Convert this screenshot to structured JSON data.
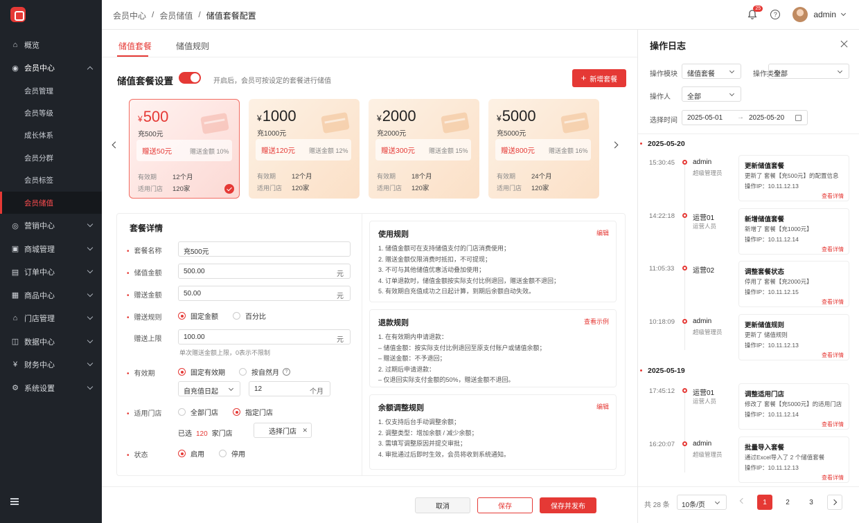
{
  "breadcrumb": {
    "items": [
      "会员中心",
      "会员储值"
    ],
    "current": "储值套餐配置",
    "sep": "/"
  },
  "header": {
    "notification_count": "25",
    "user_name": "admin"
  },
  "sidebar": {
    "items": [
      {
        "label": "概览",
        "icon": "home-icon"
      },
      {
        "label": "会员中心",
        "icon": "member-icon",
        "open": true
      },
      {
        "label": "营销中心",
        "icon": "marketing-icon"
      },
      {
        "label": "商城管理",
        "icon": "mall-icon"
      },
      {
        "label": "订单中心",
        "icon": "order-icon"
      },
      {
        "label": "商品中心",
        "icon": "goods-icon"
      },
      {
        "label": "门店管理",
        "icon": "store-icon"
      },
      {
        "label": "数据中心",
        "icon": "data-icon"
      },
      {
        "label": "财务中心",
        "icon": "finance-icon"
      },
      {
        "label": "系统设置",
        "icon": "settings-icon"
      }
    ],
    "sub_items": [
      "会员管理",
      "会员等级",
      "成长体系",
      "会员分群",
      "会员标签",
      "会员储值"
    ],
    "active_sub": "会员储值"
  },
  "tabs": [
    "储值套餐",
    "储值规则"
  ],
  "section": {
    "title": "储值套餐设置",
    "toggle_on": true,
    "hint": "开启后，会员可按设定的套餐进行储值",
    "add_label": "新增套餐"
  },
  "packages": [
    {
      "currency": "¥",
      "amount": "500",
      "name": "充500元",
      "bonus": "赠送50元",
      "ratio": "赠送金额 10%",
      "validity_label": "有效期",
      "validity": "12个月",
      "stores_label": "适用门店",
      "stores": "120家",
      "selected": true
    },
    {
      "currency": "¥",
      "amount": "1000",
      "name": "充1000元",
      "bonus": "赠送120元",
      "ratio": "赠送金额 12%",
      "validity_label": "有效期",
      "validity": "12个月",
      "stores_label": "适用门店",
      "stores": "120家",
      "selected": false
    },
    {
      "currency": "¥",
      "amount": "2000",
      "name": "充2000元",
      "bonus": "赠送300元",
      "ratio": "赠送金额 15%",
      "validity_label": "有效期",
      "validity": "18个月",
      "stores_label": "适用门店",
      "stores": "120家",
      "selected": false
    },
    {
      "currency": "¥",
      "amount": "5000",
      "name": "充5000元",
      "bonus": "赠送800元",
      "ratio": "赠送金额 16%",
      "validity_label": "有效期",
      "validity": "24个月",
      "stores_label": "适用门店",
      "stores": "120家",
      "selected": false
    }
  ],
  "detail": {
    "title": "套餐详情",
    "name_label": "套餐名称",
    "name_value": "充500元",
    "amount_label": "储值金额",
    "amount_value": "500.00",
    "bonus_label": "赠送金额",
    "bonus_value": "50.00",
    "unit_yuan": "元",
    "rule_label": "赠送规则",
    "rule_fixed": "固定金额",
    "rule_percent": "百分比",
    "cap_label": "赠送上限",
    "cap_value": "100.00",
    "cap_hint": "单次赠送金额上限，0表示不限制",
    "validity_label": "有效期",
    "validity_fixed": "固定有效期",
    "validity_natural": "按自然月",
    "start_select": "自充值日起",
    "months_value": "12",
    "months_unit": "个月",
    "stores_label": "适用门店",
    "stores_all": "全部门店",
    "stores_specified": "指定门店",
    "selected_prefix": "已选",
    "selected_count": "120",
    "selected_suffix": "家门店",
    "select_store_button": "选择门店",
    "status_label": "状态",
    "status_on": "启用",
    "status_off": "停用"
  },
  "rules": [
    {
      "title": "使用规则",
      "action": "编辑",
      "lines": [
        "1. 储值金额可在支持储值支付的门店消费使用；",
        "2. 赠送金额仅限消费时抵扣，不可提现；",
        "3. 不可与其他储值优惠活动叠加使用；",
        "4. 订单退款时，储值金额按实际支付比例退回，赠送金额不退回；",
        "5. 有效期自充值成功之日起计算，到期后余额自动失效。"
      ]
    },
    {
      "title": "退款规则",
      "action": "查看示例",
      "lines": [
        "1. 在有效期内申请退款：",
        "– 储值金额：按实际支付比例退回至原支付账户或储值余额；",
        "– 赠送金额：不予退回；",
        "2. 过期后申请退款：",
        "– 仅退回实际支付金额的50%，赠送金额不退回。"
      ]
    },
    {
      "title": "余额调整规则",
      "action": "编辑",
      "lines": [
        "1. 仅支持后台手动调整余额；",
        "2. 调整类型：增加余额 / 减少余额；",
        "3. 需填写调整原因并提交审批；",
        "4. 审批通过后即时生效，会员将收到系统通知。"
      ]
    }
  ],
  "footer": {
    "cancel": "取消",
    "save": "保存",
    "publish": "保存并发布"
  },
  "log": {
    "title": "操作日志",
    "filters": {
      "module_label": "操作模块",
      "module_value": "储值套餐",
      "type_label": "操作类型",
      "type_value": "全部",
      "operator_label": "操作人",
      "operator_value": "全部",
      "time_label": "选择时间",
      "date_from": "2025-05-01",
      "date_to": "2025-05-20",
      "range_arrow": "→"
    },
    "days": [
      {
        "date": "2025-05-20",
        "entries": [
          {
            "time": "15:30:45",
            "user": "admin",
            "role": "超级管理员",
            "action": "更新储值套餐",
            "desc": "更新了 套餐【充500元】的配置信息",
            "ip": "操作IP：10.11.12.13",
            "link": "查看详情"
          },
          {
            "time": "14:22:18",
            "user": "运营01",
            "role": "运营人员",
            "action": "新增储值套餐",
            "desc": "新增了 套餐【充1000元】",
            "ip": "操作IP：10.11.12.14",
            "link": "查看详情"
          },
          {
            "time": "11:05:33",
            "user": "运营02",
            "role": "",
            "action": "调整套餐状态",
            "desc": "停用了 套餐【充2000元】",
            "ip": "操作IP：10.11.12.15",
            "link": "查看详情"
          },
          {
            "time": "10:18:09",
            "user": "admin",
            "role": "超级管理员",
            "action": "更新储值规则",
            "desc": "更新了 储值规则",
            "ip": "操作IP：10.11.12.13",
            "link": "查看详情"
          }
        ]
      },
      {
        "date": "2025-05-19",
        "entries": [
          {
            "time": "17:45:12",
            "user": "运营01",
            "role": "运营人员",
            "action": "调整适用门店",
            "desc": "修改了 套餐【充5000元】的适用门店",
            "ip": "操作IP：10.11.12.14",
            "link": "查看详情"
          },
          {
            "time": "16:20:07",
            "user": "admin",
            "role": "超级管理员",
            "action": "批量导入套餐",
            "desc": "通过Excel导入了 2 个储值套餐",
            "ip": "操作IP：10.11.12.13",
            "link": "查看详情"
          }
        ]
      }
    ],
    "pager": {
      "total": "共 28 条",
      "page_size": "10条/页",
      "pages": [
        "1",
        "2",
        "3"
      ],
      "current": "1"
    }
  }
}
